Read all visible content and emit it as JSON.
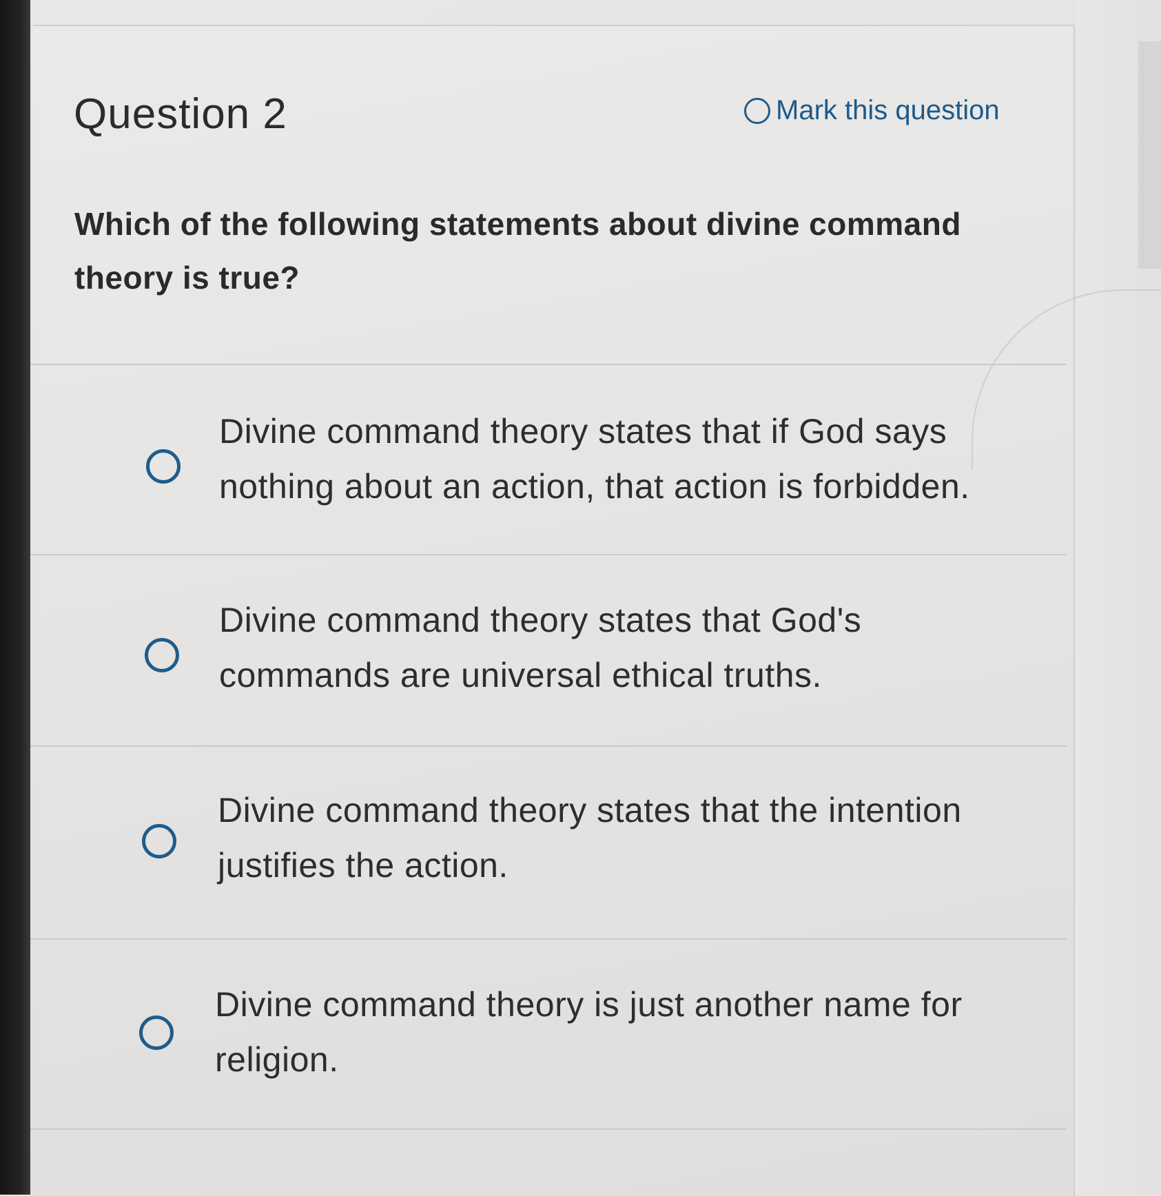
{
  "question": {
    "title": "Question 2",
    "mark_label": "Mark this question",
    "prompt": "Which of the following statements about divine command theory is true?"
  },
  "options": [
    "Divine command theory states that if God says nothing about an action, that action is forbidden.",
    "Divine command theory states that God's commands are universal ethical truths.",
    "Divine command theory states that the intention justifies the action.",
    "Divine command theory is just another name for religion."
  ],
  "colors": {
    "accent": "#1f5c8c",
    "text": "#2b2b2b",
    "background": "#e6e5e3"
  }
}
